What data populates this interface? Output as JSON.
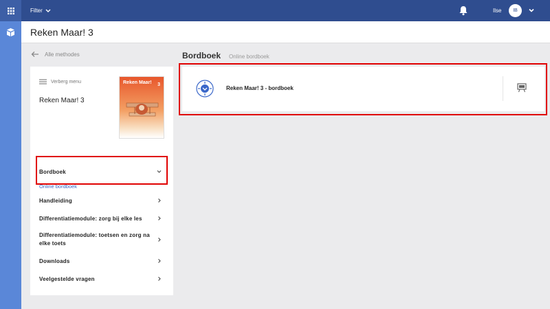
{
  "topbar": {
    "filter_label": "Filter",
    "username": "Ilse",
    "avatar_initials": "IB"
  },
  "header": {
    "title": "Reken Maar! 3"
  },
  "back_link": "Alle methodes",
  "panel": {
    "hide_menu": "Verberg menu",
    "method_title": "Reken Maar! 3",
    "cover": {
      "title": "Reken Maar!",
      "grade": "3"
    },
    "menu": [
      {
        "label": "Bordboek"
      },
      {
        "label": "Handleiding"
      },
      {
        "label": "Differentiatiemodule: zorg bij elke les"
      },
      {
        "label": "Differentiatiemodule: toetsen en zorg na elke toets"
      },
      {
        "label": "Downloads"
      },
      {
        "label": "Veelgestelde vragen"
      }
    ],
    "submenu": {
      "label": "Online bordboek"
    }
  },
  "content": {
    "section_title": "Bordboek",
    "section_subtitle": "Online bordboek",
    "card": {
      "title": "Reken Maar! 3 - bordboek"
    }
  },
  "colors": {
    "accent_blue": "#2f4d8f",
    "rail_blue": "#5a87d8",
    "link_blue": "#3a67c9",
    "highlight_red": "#e00000"
  }
}
